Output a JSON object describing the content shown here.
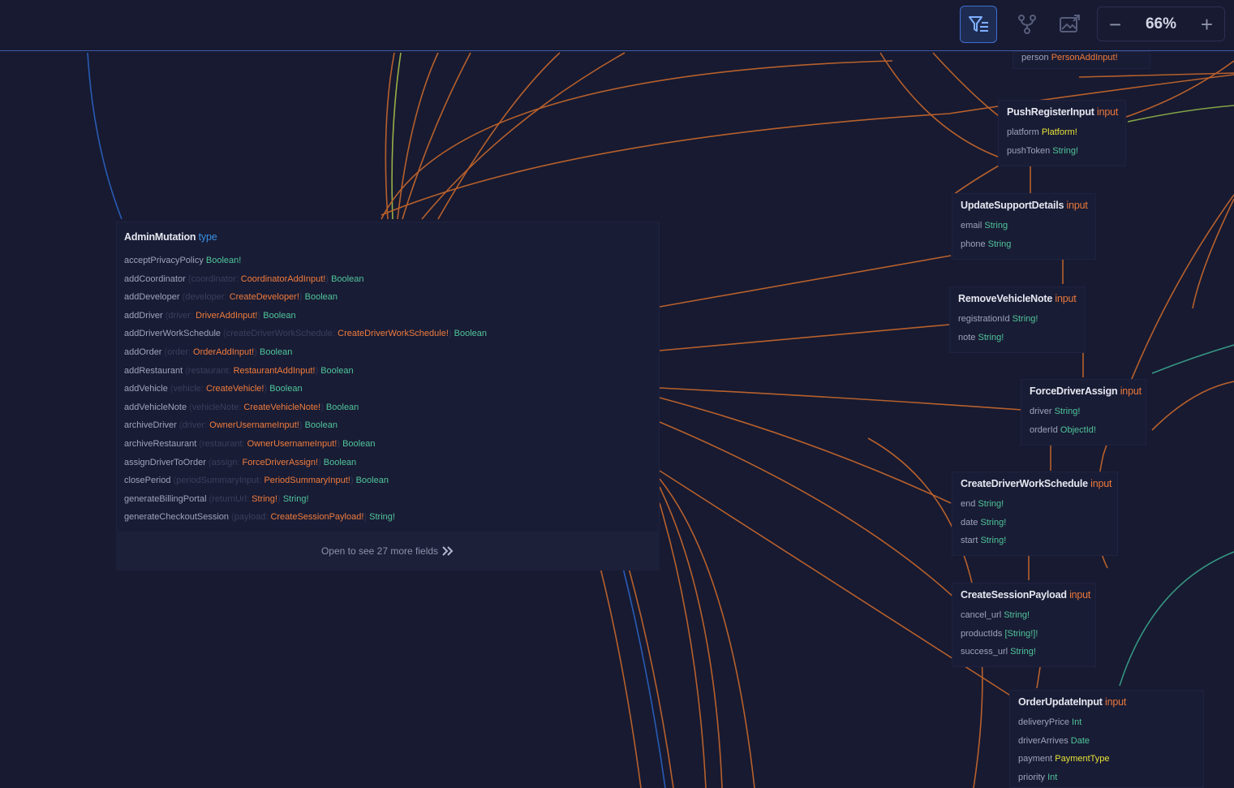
{
  "toolbar": {
    "filter_icon": "filter-list-icon",
    "branch_icon": "branch-icon",
    "image_icon": "image-export-icon",
    "zoom": {
      "minus": "−",
      "value": "66%",
      "plus": "+"
    }
  },
  "colors": {
    "background": "#171a31",
    "input_kind": "#e9783b",
    "type_kind": "#3b8fe0",
    "object_type": "#ef7c3c",
    "scalar_type": "#4fc59a",
    "enum_type": "#e6e23a"
  },
  "admin": {
    "name": "AdminMutation",
    "kind": "type",
    "fields": [
      {
        "name": "acceptPrivacyPolicy",
        "argName": "",
        "argType": "",
        "ret": "Boolean!"
      },
      {
        "name": "addCoordinator",
        "argName": "coordinator",
        "argType": "CoordinatorAddInput!",
        "ret": "Boolean"
      },
      {
        "name": "addDeveloper",
        "argName": "developer",
        "argType": "CreateDeveloper!",
        "ret": "Boolean"
      },
      {
        "name": "addDriver",
        "argName": "driver",
        "argType": "DriverAddInput!",
        "ret": "Boolean"
      },
      {
        "name": "addDriverWorkSchedule",
        "argName": "createDriverWorkSchedule",
        "argType": "CreateDriverWorkSchedule!",
        "ret": "Boolean"
      },
      {
        "name": "addOrder",
        "argName": "order",
        "argType": "OrderAddInput!",
        "ret": "Boolean"
      },
      {
        "name": "addRestaurant",
        "argName": "restaurant",
        "argType": "RestaurantAddInput!",
        "ret": "Boolean"
      },
      {
        "name": "addVehicle",
        "argName": "vehicle",
        "argType": "CreateVehicle!",
        "ret": "Boolean"
      },
      {
        "name": "addVehicleNote",
        "argName": "vehicleNote",
        "argType": "CreateVehicleNote!",
        "ret": "Boolean"
      },
      {
        "name": "archiveDriver",
        "argName": "driver",
        "argType": "OwnerUsernameInput!",
        "ret": "Boolean"
      },
      {
        "name": "archiveRestaurant",
        "argName": "restaurant",
        "argType": "OwnerUsernameInput!",
        "ret": "Boolean"
      },
      {
        "name": "assignDriverToOrder",
        "argName": "assign",
        "argType": "ForceDriverAssign!",
        "ret": "Boolean"
      },
      {
        "name": "closePeriod",
        "argName": "periodSummaryInput",
        "argType": "PeriodSummaryInput!",
        "ret": "Boolean"
      },
      {
        "name": "generateBillingPortal",
        "argName": "returnUrl",
        "argType": "String!",
        "ret": "String!"
      },
      {
        "name": "generateCheckoutSession",
        "argName": "payload",
        "argType": "CreateSessionPayload!",
        "ret": "String!"
      }
    ],
    "more": "Open to see 27 more fields",
    "more_icon": "chevrons-right-icon"
  },
  "nodes": {
    "personPartial": {
      "name": "person",
      "type": "PersonAddInput!"
    },
    "pushRegister": {
      "name": "PushRegisterInput",
      "kind": "input",
      "fields": [
        {
          "name": "platform",
          "type": "Platform!"
        },
        {
          "name": "pushToken",
          "type": "String!"
        }
      ]
    },
    "updateSupport": {
      "name": "UpdateSupportDetails",
      "kind": "input",
      "fields": [
        {
          "name": "email",
          "type": "String"
        },
        {
          "name": "phone",
          "type": "String"
        }
      ]
    },
    "removeVehicleNote": {
      "name": "RemoveVehicleNote",
      "kind": "input",
      "fields": [
        {
          "name": "registrationId",
          "type": "String!"
        },
        {
          "name": "note",
          "type": "String!"
        }
      ]
    },
    "forceDriverAssign": {
      "name": "ForceDriverAssign",
      "kind": "input",
      "fields": [
        {
          "name": "driver",
          "type": "String!"
        },
        {
          "name": "orderId",
          "type": "ObjectId!"
        }
      ]
    },
    "createDriverWorkSchedule": {
      "name": "CreateDriverWorkSchedule",
      "kind": "input",
      "fields": [
        {
          "name": "end",
          "type": "String!"
        },
        {
          "name": "date",
          "type": "String!"
        },
        {
          "name": "start",
          "type": "String!"
        }
      ]
    },
    "createSessionPayload": {
      "name": "CreateSessionPayload",
      "kind": "input",
      "fields": [
        {
          "name": "cancel_url",
          "type": "String!"
        },
        {
          "name": "productIds",
          "type": "[String!]!"
        },
        {
          "name": "success_url",
          "type": "String!"
        }
      ]
    },
    "orderUpdate": {
      "name": "OrderUpdateInput",
      "kind": "input",
      "fields": [
        {
          "name": "deliveryPrice",
          "type": "Int"
        },
        {
          "name": "driverArrives",
          "type": "Date"
        },
        {
          "name": "payment",
          "type": "PaymentType"
        },
        {
          "name": "priority",
          "type": "Int"
        }
      ]
    }
  }
}
